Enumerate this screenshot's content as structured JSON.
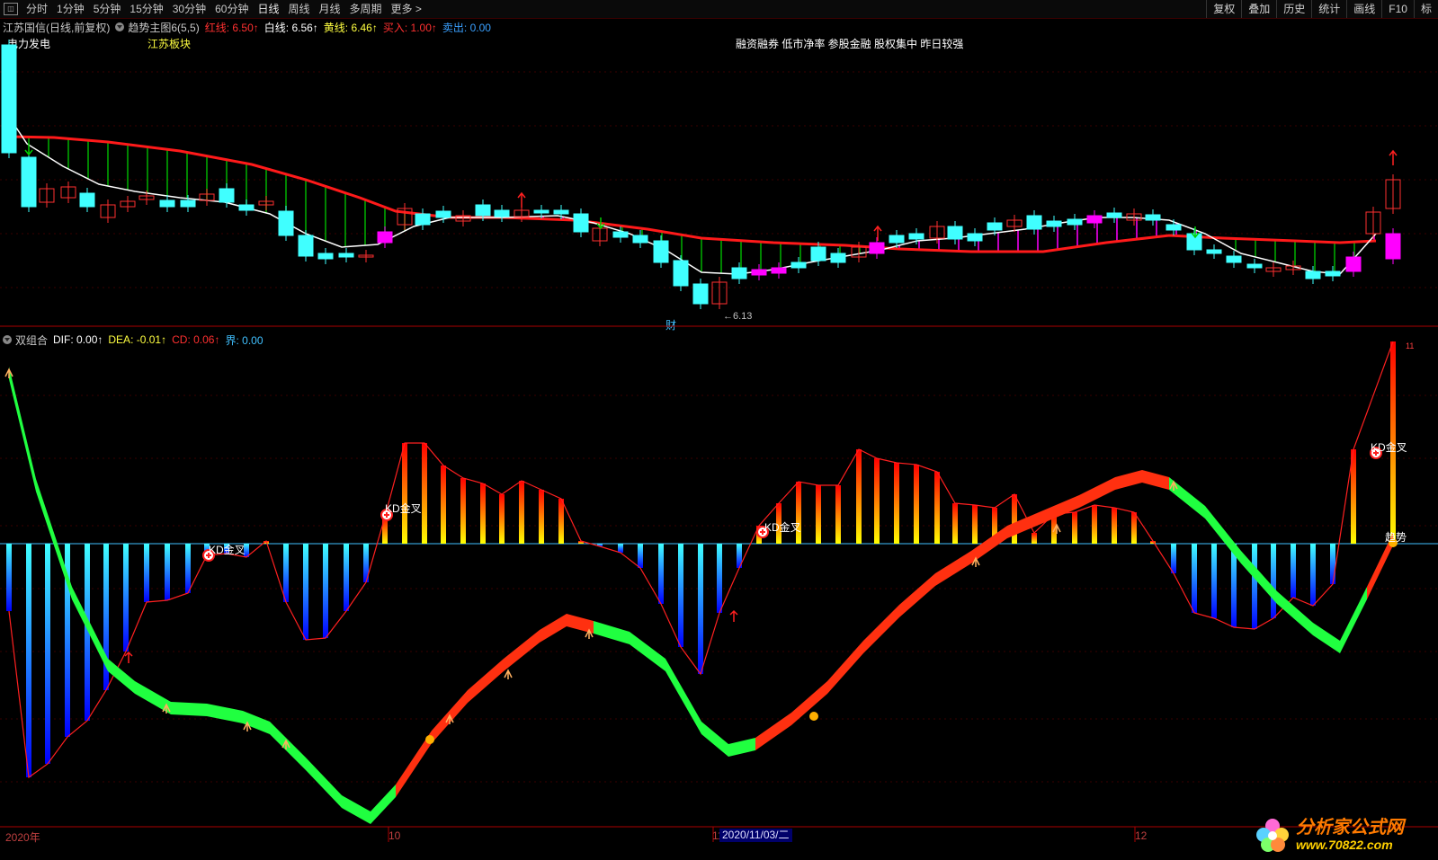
{
  "toolbar": {
    "items": [
      "分时",
      "1分钟",
      "5分钟",
      "15分钟",
      "30分钟",
      "60分钟",
      "日线",
      "周线",
      "月线",
      "多周期",
      "更多 >"
    ],
    "active_index": 6,
    "right_items": [
      "复权",
      "叠加",
      "历史",
      "统计",
      "画线",
      "F10",
      "标"
    ]
  },
  "main_panel": {
    "stock": "江苏国信",
    "period": "(日线,前复权)",
    "indicator": "趋势主图6(5,5)",
    "red_line_label": "红线:",
    "red_line_value": "6.50",
    "white_line_label": "白线:",
    "white_line_value": "6.56",
    "yellow_line_label": "黄线:",
    "yellow_line_value": "6.46",
    "buy_label": "买入:",
    "buy_value": "1.00",
    "sell_label": "卖出:",
    "sell_value": "0.00",
    "tag_left": "电力发电",
    "tag_mid": "江苏板块",
    "tag_right": "融资融券 低市净率 参股金融 股权集中 昨日较强",
    "low_mark": "6.13",
    "cai_mark": "财"
  },
  "sub_panel": {
    "indicator": "双组合",
    "dif_label": "DIF:",
    "dif_value": "0.00",
    "dea_label": "DEA:",
    "dea_value": "-0.01",
    "cd_label": "CD:",
    "cd_value": "0.06",
    "jie_label": "界:",
    "jie_value": "0.00",
    "kd_labels": [
      "KD金叉",
      "KD金叉",
      "KD金叉",
      "KD金叉"
    ],
    "trend_label": "趋势",
    "top_mark": "11"
  },
  "xaxis": {
    "labels": [
      "2020年",
      "10",
      "11",
      "12"
    ],
    "date_box": "2020/11/03/二"
  },
  "watermark": {
    "cn": "分析家公式网",
    "url": "www.70822.com"
  },
  "colors": {
    "red": "#ff2020",
    "cyan": "#40ffff",
    "magenta": "#ff00ff",
    "green": "#00c000",
    "white": "#ffffff",
    "yellow": "#ffff40",
    "blue": "#3aa0ff"
  }
}
